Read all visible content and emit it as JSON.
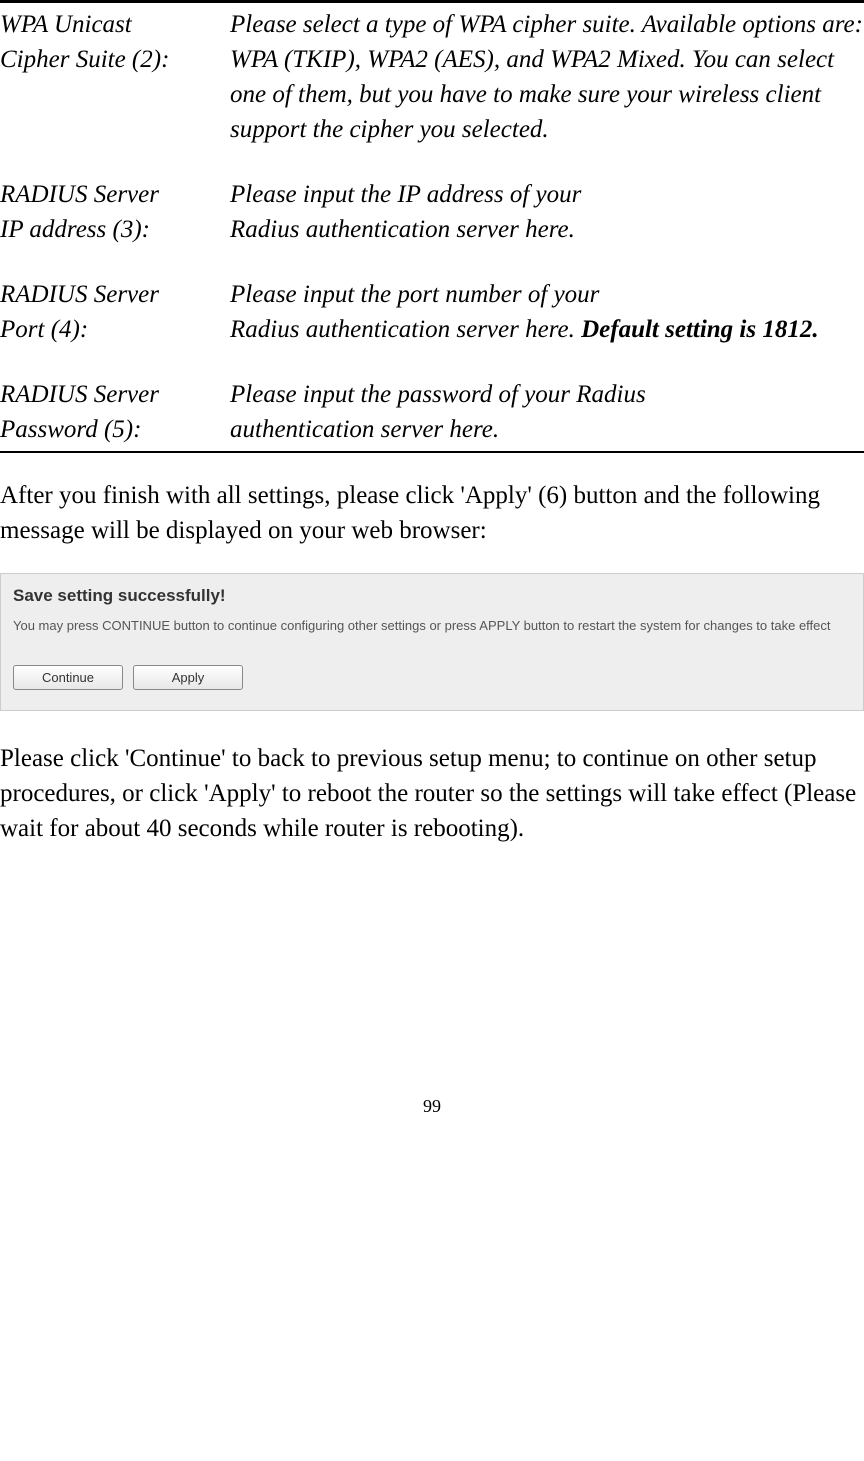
{
  "settings": {
    "wpa_cipher": {
      "label_line1": "WPA Unicast",
      "label_line2": "Cipher Suite (2):",
      "desc": "Please select a type of WPA cipher suite. Available options are: WPA (TKIP), WPA2 (AES), and WPA2 Mixed. You can select one of them, but you have to make sure your wireless client support the cipher you selected."
    },
    "radius_ip": {
      "label_line1": "RADIUS Server",
      "label_line2": "IP address (3):",
      "desc_line1": "Please input the IP address of your",
      "desc_line2": "Radius authentication server here."
    },
    "radius_port": {
      "label_line1": "RADIUS Server",
      "label_line2": "Port (4):",
      "desc_line1": "Please input the port number of your",
      "desc_line2_prefix": "Radius authentication server here. ",
      "desc_line2_bold": "Default setting is 1812."
    },
    "radius_password": {
      "label_line1": "RADIUS Server",
      "label_line2": "Password (5):",
      "desc_line1": "Please input the password of your Radius",
      "desc_line2": "authentication server here."
    }
  },
  "body": {
    "para1": "After you finish with all settings, please click 'Apply' (6) button and the following message will be displayed on your web browser:",
    "para2": "Please click 'Continue' to back to previous setup menu; to continue on other setup procedures, or click 'Apply' to reboot the router so the settings will take effect (Please wait for about 40 seconds while router is rebooting)."
  },
  "dialog": {
    "title": "Save setting successfully!",
    "text": "You may press CONTINUE button to continue configuring other settings or press APPLY button to restart the system for changes to take effect",
    "continue_label": "Continue",
    "apply_label": "Apply"
  },
  "page_number": "99"
}
